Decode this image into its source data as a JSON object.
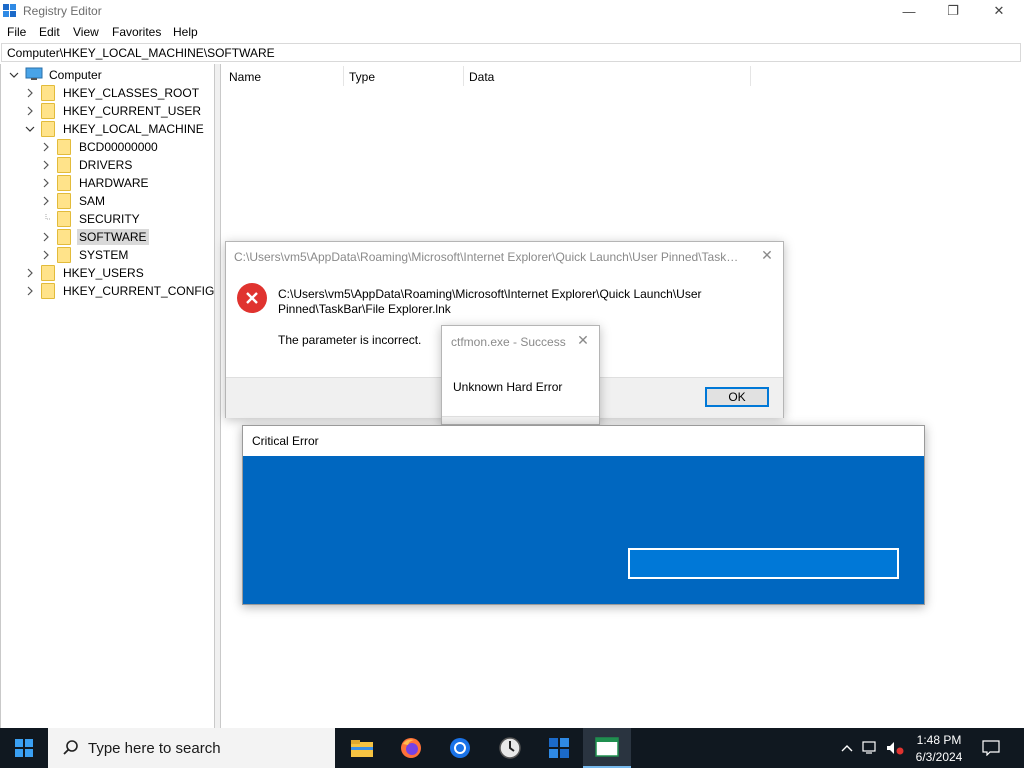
{
  "window": {
    "title": "Registry Editor",
    "controls": {
      "minimize": "—",
      "maximize": "❐",
      "close": "✕"
    }
  },
  "menu": [
    "File",
    "Edit",
    "View",
    "Favorites",
    "Help"
  ],
  "address": "Computer\\HKEY_LOCAL_MACHINE\\SOFTWARE",
  "tree": {
    "root": "Computer",
    "items": [
      {
        "label": "HKEY_CLASSES_ROOT",
        "expanded": false
      },
      {
        "label": "HKEY_CURRENT_USER",
        "expanded": false
      },
      {
        "label": "HKEY_LOCAL_MACHINE",
        "expanded": true
      },
      {
        "label": "BCD00000000",
        "expanded": false
      },
      {
        "label": "DRIVERS",
        "expanded": false
      },
      {
        "label": "HARDWARE",
        "expanded": false
      },
      {
        "label": "SAM",
        "expanded": false
      },
      {
        "label": "SECURITY",
        "expanded": false
      },
      {
        "label": "SOFTWARE",
        "expanded": false,
        "selected": true
      },
      {
        "label": "SYSTEM",
        "expanded": false
      },
      {
        "label": "HKEY_USERS",
        "expanded": false
      },
      {
        "label": "HKEY_CURRENT_CONFIG",
        "expanded": false
      }
    ]
  },
  "list": {
    "columns": [
      "Name",
      "Type",
      "Data"
    ]
  },
  "dialog_path_error": {
    "title": "C:\\Users\\vm5\\AppData\\Roaming\\Microsoft\\Internet Explorer\\Quick Launch\\User Pinned\\TaskB...",
    "path_line1": "C:\\Users\\vm5\\AppData\\Roaming\\Microsoft\\Internet Explorer\\Quick Launch\\User",
    "path_line2": "Pinned\\TaskBar\\File Explorer.lnk",
    "message": "The parameter is incorrect.",
    "ok": "OK",
    "close": "✕"
  },
  "dialog_ctfmon": {
    "title": "ctfmon.exe - Success",
    "message": "Unknown Hard Error",
    "close": "✕"
  },
  "critical_error": {
    "title": "Critical Error",
    "background_color": "#0067c0"
  },
  "taskbar": {
    "search_placeholder": "Type here to search",
    "apps": [
      "file-explorer-icon",
      "firefox-icon",
      "chrome-icon",
      "clock-app-icon",
      "registry-editor-icon",
      "app-window-icon"
    ],
    "time": "1:48 PM",
    "date": "6/3/2024"
  },
  "colors": {
    "accent": "#0078d7",
    "error_red": "#e0332f",
    "taskbar": "#101820",
    "critical_blue": "#0067c0"
  }
}
